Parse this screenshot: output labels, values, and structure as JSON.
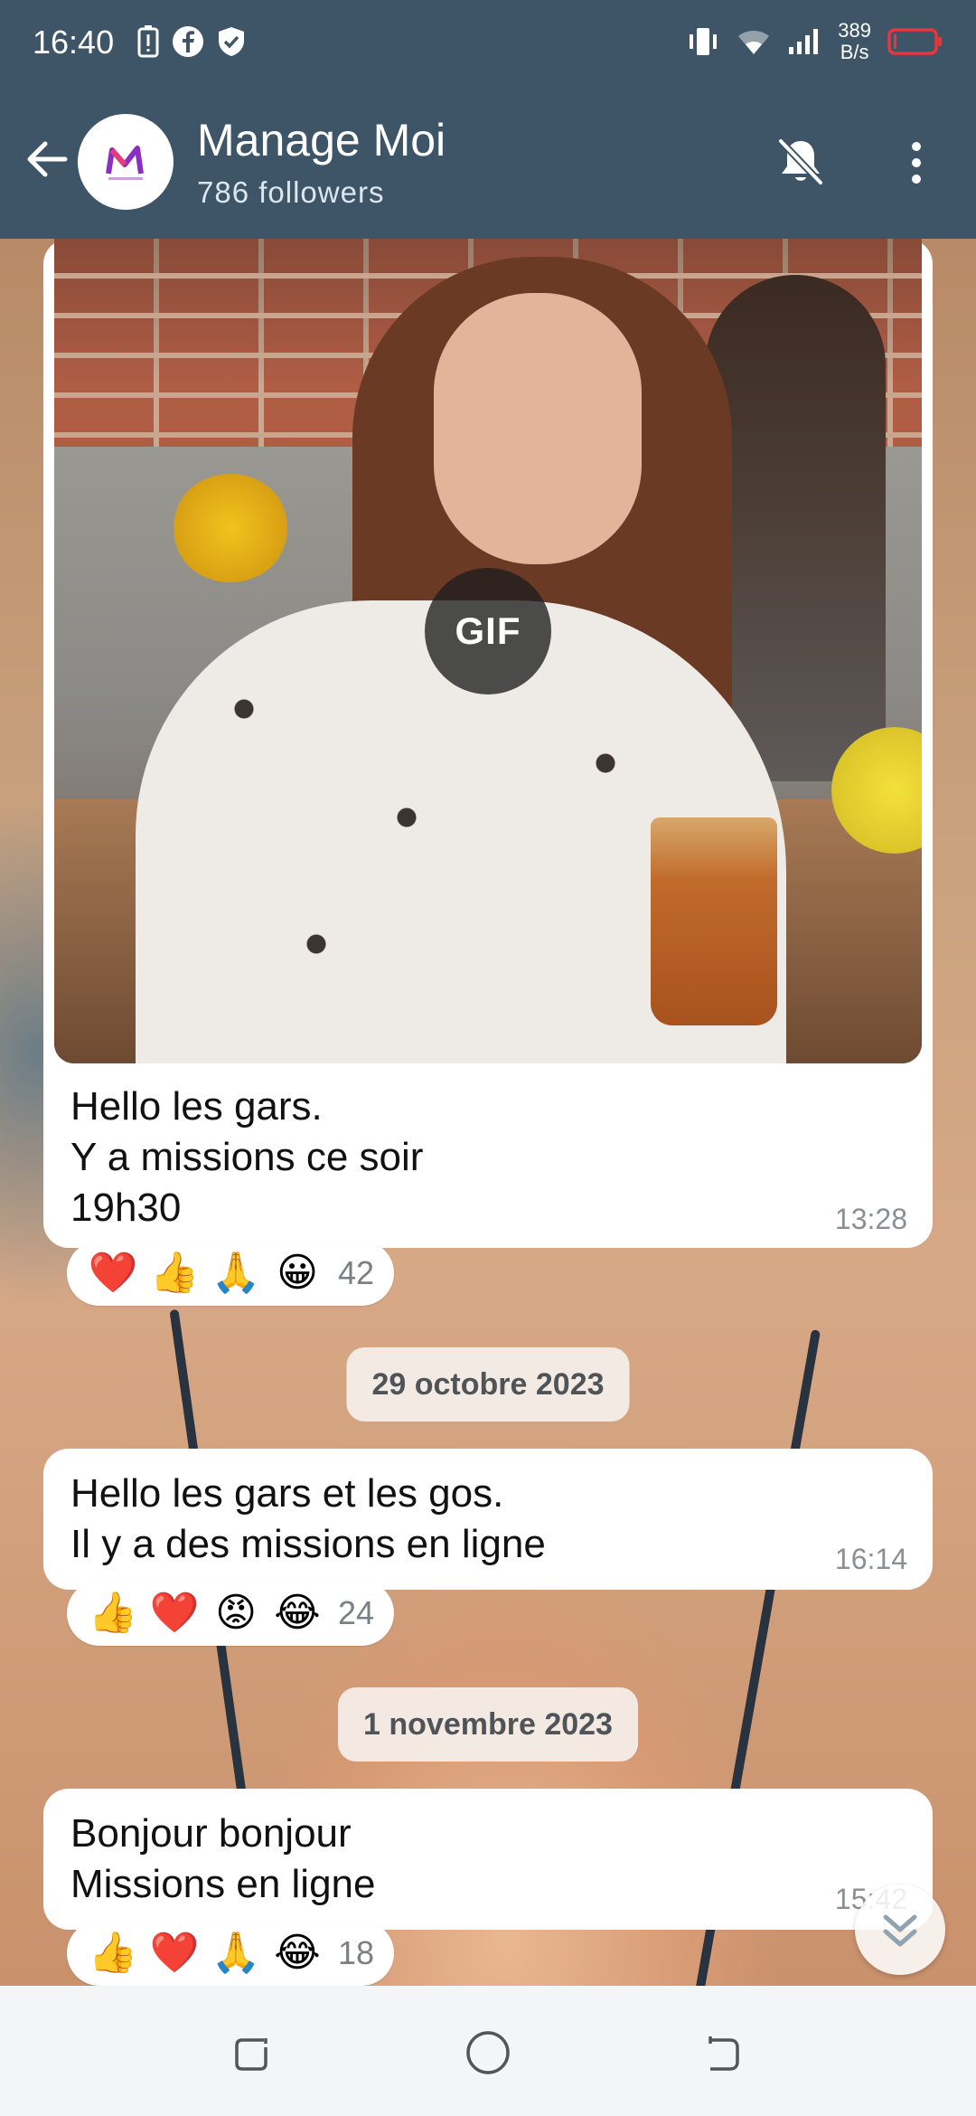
{
  "status_bar": {
    "time": "16:40",
    "net_speed_top": "389",
    "net_speed_bottom": "B/s"
  },
  "header": {
    "title": "Manage Moi",
    "subtitle": "786 followers"
  },
  "messages": [
    {
      "gif_label": "GIF",
      "lines": [
        "Hello les gars.",
        "Y a missions ce soir",
        "19h30"
      ],
      "time": "13:28",
      "reactions": [
        "❤️",
        "👍",
        "🙏",
        "😀"
      ],
      "reaction_count": "42"
    },
    {
      "date": "29 octobre 2023",
      "lines": [
        "Hello les gars et les gos.",
        "Il y a des missions en ligne"
      ],
      "time": "16:14",
      "reactions": [
        "👍",
        "❤️",
        "😡",
        "😂"
      ],
      "reaction_count": "24"
    },
    {
      "date": "1 novembre 2023",
      "lines": [
        "Bonjour bonjour",
        "Missions en ligne"
      ],
      "time": "15:42",
      "reactions": [
        "👍",
        "❤️",
        "🙏",
        "😂"
      ],
      "reaction_count": "18"
    }
  ],
  "colors": {
    "header_bg": "#3d5566",
    "bubble_bg": "#ffffff",
    "time_color": "#8a8f93"
  },
  "icons": {
    "back": "arrow-left-icon",
    "mute": "bell-off-icon",
    "menu": "more-vertical-icon",
    "scroll_down": "chevron-double-down-icon"
  }
}
